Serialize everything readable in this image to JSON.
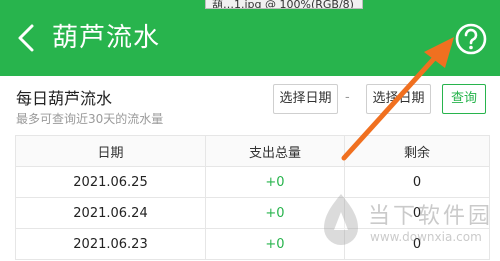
{
  "window": {
    "tooltip": "葫…1.jpg @ 100%(RGB/8)"
  },
  "header": {
    "title": "葫芦流水",
    "help_icon": "question-circle-icon",
    "back_icon": "chevron-left-icon"
  },
  "section": {
    "title": "每日葫芦流水",
    "subtitle": "最多可查询近30天的流水量"
  },
  "filter": {
    "start_label": "选择日期",
    "separator": "-",
    "end_label": "选择日期",
    "query_label": "查询"
  },
  "table": {
    "headers": [
      "日期",
      "支出总量",
      "剩余"
    ],
    "rows": [
      {
        "date": "2021.06.25",
        "expense": "+0",
        "remain": "0"
      },
      {
        "date": "2021.06.24",
        "expense": "+0",
        "remain": "0"
      },
      {
        "date": "2021.06.23",
        "expense": "+0",
        "remain": "0"
      }
    ]
  },
  "watermark": {
    "name": "当下软件园",
    "url": "www.downxia.com"
  },
  "colors": {
    "brand": "#28b44d",
    "annotation_arrow": "#f07020"
  }
}
